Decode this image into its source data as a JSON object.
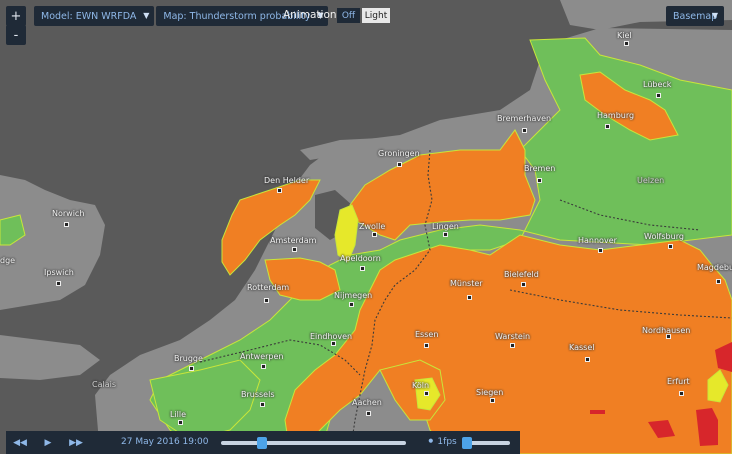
{
  "zoom": {
    "in_label": "+",
    "out_label": "-"
  },
  "toolbar": {
    "model_label": "Model: EWN WRFDA",
    "map_label": "Map: Thunderstorm probability",
    "animation_label": "Animation:",
    "anim_off": "Off",
    "anim_light": "Light",
    "basemap_label": "Basemap"
  },
  "cities": [
    {
      "name": "Kiel"
    },
    {
      "name": "Lübeck"
    },
    {
      "name": "Bremerhaven"
    },
    {
      "name": "Hamburg"
    },
    {
      "name": "Groningen"
    },
    {
      "name": "Bremen"
    },
    {
      "name": "Den Helder"
    },
    {
      "name": "Uelzen"
    },
    {
      "name": "Norwich"
    },
    {
      "name": "Zwolle"
    },
    {
      "name": "Lingen"
    },
    {
      "name": "Amsterdam"
    },
    {
      "name": "Hannover"
    },
    {
      "name": "Wolfsburg"
    },
    {
      "name": "Apeldoorn"
    },
    {
      "name": "Ipswich"
    },
    {
      "name": "Bielefeld"
    },
    {
      "name": "Magdebu"
    },
    {
      "name": "Rotterdam"
    },
    {
      "name": "Münster"
    },
    {
      "name": "Nijmegen"
    },
    {
      "name": "Eindhoven"
    },
    {
      "name": "Essen"
    },
    {
      "name": "Warstein"
    },
    {
      "name": "Nordhausen"
    },
    {
      "name": "Brugge"
    },
    {
      "name": "Antwerpen"
    },
    {
      "name": "Kassel"
    },
    {
      "name": "Calais"
    },
    {
      "name": "Köln"
    },
    {
      "name": "Brussels"
    },
    {
      "name": "Siegen"
    },
    {
      "name": "Erfurt"
    },
    {
      "name": "Aachen"
    },
    {
      "name": "Lille"
    },
    {
      "name": "dge"
    }
  ],
  "timeline": {
    "date": "27 May 2016 19:00",
    "fps": "1fps",
    "progress": 0.22,
    "speed": 0.1
  },
  "colors": {
    "land": "#8c8c8c",
    "sea": "#5a5a5a",
    "green": "#6fbf5a",
    "orange": "#f07f23",
    "yellow": "#e6e82a",
    "red": "#d7262b",
    "panel": "#1f2a37",
    "accent": "#4da3e8"
  }
}
